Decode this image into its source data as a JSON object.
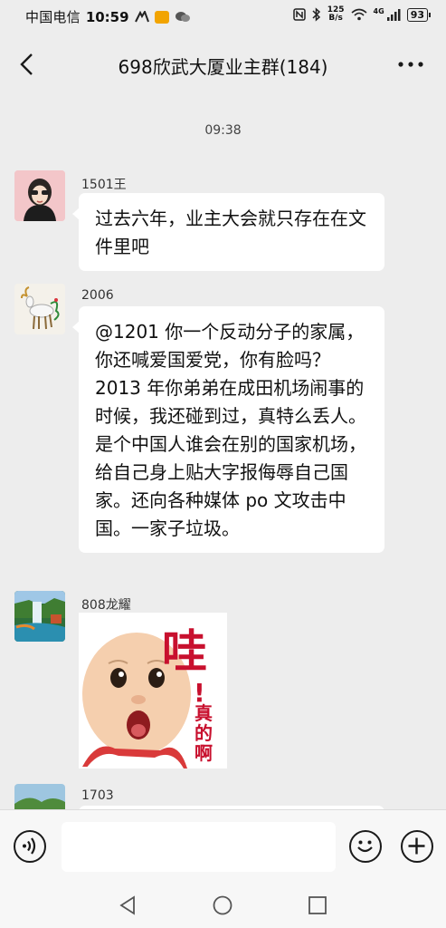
{
  "status_bar": {
    "carrier": "中国电信",
    "time": "10:59",
    "net_speed_value": "125",
    "net_speed_unit": "B/s",
    "signal_label": "4G",
    "battery": "93"
  },
  "chat": {
    "title": "698欣武大厦业主群(184)"
  },
  "timestamp": "09:38",
  "messages": [
    {
      "sender": "1501王",
      "text": "过去六年，业主大会就只存在在文件里吧"
    },
    {
      "sender": "2006",
      "text": "@1201 你一个反动分子的家属，你还喊爱国爱党，你有脸吗？2013 年你弟弟在成田机场闹事的时候，我还碰到过，真特么丢人。是个中国人谁会在别的国家机场，给自己身上贴大字报侮辱自己国家。还向各种媒体 po 文攻击中国。一家子垃圾。"
    },
    {
      "sender": "808龙耀",
      "sticker": {
        "big_char": "哇",
        "mark": "!",
        "line1": "真",
        "line2": "的",
        "line3": "啊"
      }
    },
    {
      "sender": "1703"
    }
  ],
  "input": {
    "placeholder": ""
  },
  "icons": {
    "back": "chevron-left-icon",
    "more": "more-dots-icon",
    "voice": "voice-icon",
    "emoji": "emoji-icon",
    "plus": "plus-icon"
  },
  "colors": {
    "background": "#ededed",
    "bubble": "#ffffff",
    "sticker_text": "#c8102e"
  }
}
